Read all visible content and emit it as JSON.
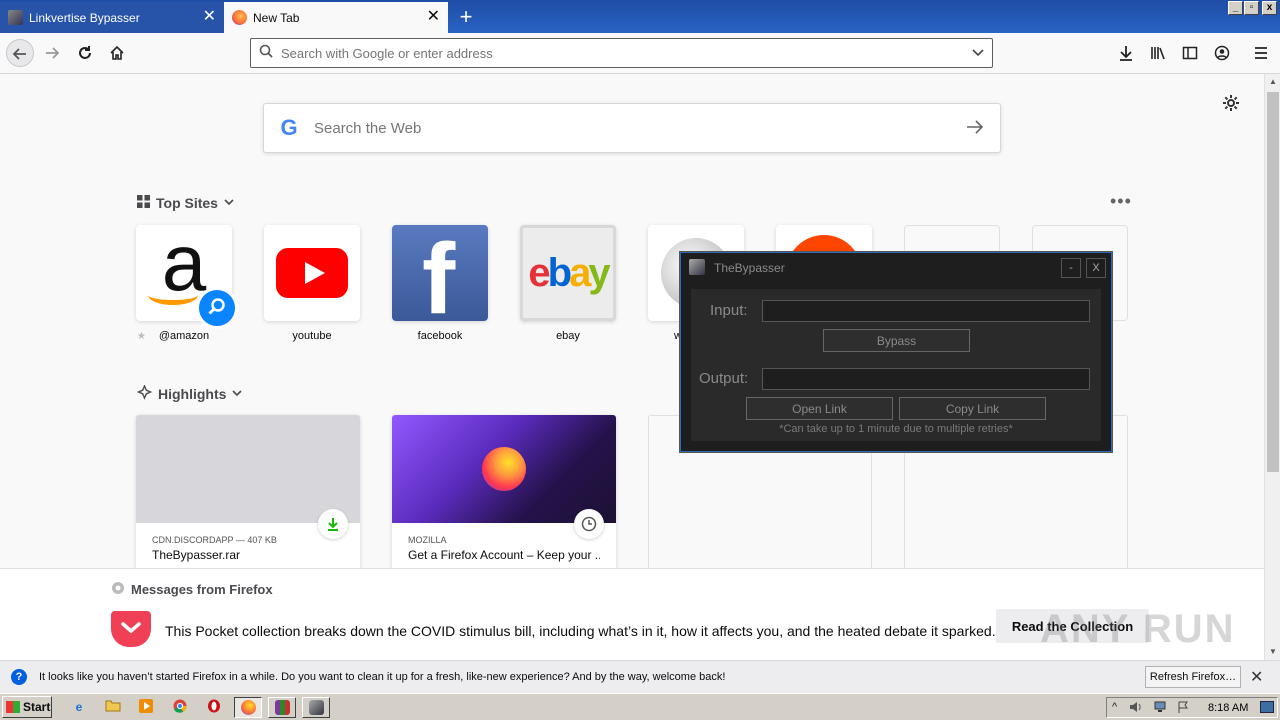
{
  "tabs": [
    {
      "title": "Linkvertise Bypasser",
      "close": "✕"
    },
    {
      "title": "New Tab",
      "close": "✕"
    }
  ],
  "new_tab_glyph": "+",
  "window_controls": {
    "minimize": "_",
    "restore": "▫",
    "close": "x"
  },
  "urlbar": {
    "placeholder": "Search with Google or enter address"
  },
  "websearch": {
    "placeholder": "Search the Web",
    "logo": "G"
  },
  "top_sites": {
    "title": "Top Sites",
    "sites": [
      {
        "label": "@amazon"
      },
      {
        "label": "youtube"
      },
      {
        "label": "facebook"
      },
      {
        "label": "ebay"
      },
      {
        "label": "w"
      },
      {
        "label": ""
      },
      {
        "label": ""
      },
      {
        "label": ""
      }
    ]
  },
  "highlights": {
    "title": "Highlights",
    "cards": [
      {
        "source": "CDN.DISCORDAPP — 407 KB",
        "title": "TheBypasser.rar"
      },
      {
        "source": "MOZILLA",
        "title": "Get a Firefox Account – Keep your ..."
      }
    ]
  },
  "messages": {
    "title": "Messages from Firefox",
    "text": "This Pocket collection breaks down the COVID stimulus bill, including what’s in it, how it affects you, and the heated debate it sparked.",
    "button": "Read the Collection",
    "watermark": "ANY RUN"
  },
  "notification": {
    "text": "It looks like you haven’t started Firefox in a while. Do you want to clean it up for a fresh, like-new experience? And by the way, welcome back!",
    "button": "Refresh Firefox…",
    "close": "✕"
  },
  "bypasser": {
    "title": "TheBypasser",
    "minimize": "-",
    "close": "X",
    "input_label": "Input:",
    "input_value": "",
    "bypass_button": "Bypass",
    "output_label": "Output:",
    "output_value": "",
    "open_link_button": "Open Link",
    "copy_link_button": "Copy Link",
    "note": "*Can take up to 1 minute due to multiple retries*"
  },
  "taskbar": {
    "start_label": "Start",
    "clock": "8:18 AM"
  },
  "colors": {
    "firefox_blue": "#0a84ff",
    "pocket_red": "#ef4056",
    "titlebar_blue": "#2a63c5",
    "youtube_red": "#ff0000",
    "facebook_blue": "#3b5998"
  },
  "icons": [
    "back-icon",
    "forward-icon",
    "reload-icon",
    "home-icon",
    "search-icon",
    "dropdown-icon",
    "downloads-icon",
    "library-icon",
    "sidebar-icon",
    "account-icon",
    "menu-icon",
    "gear-icon",
    "grid-icon",
    "highlights-icon",
    "pocket-icon",
    "info-icon"
  ]
}
